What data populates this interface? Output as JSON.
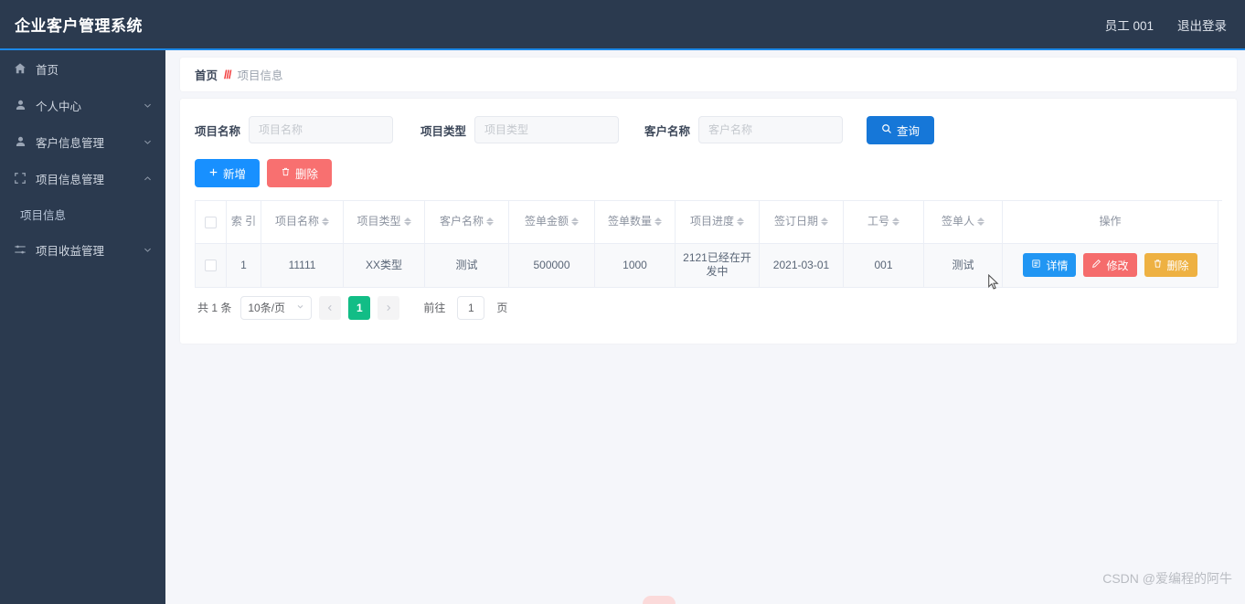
{
  "header": {
    "title": "企业客户管理系统",
    "user": "员工 001",
    "logout": "退出登录"
  },
  "sidebar": {
    "items": [
      {
        "label": "首页",
        "icon": "home-icon",
        "arrow": "",
        "sub": false
      },
      {
        "label": "个人中心",
        "icon": "user-icon",
        "arrow": "chevron-down-icon",
        "sub": false
      },
      {
        "label": "客户信息管理",
        "icon": "user-icon",
        "arrow": "chevron-down-icon",
        "sub": false
      },
      {
        "label": "项目信息管理",
        "icon": "bracket-icon",
        "arrow": "chevron-up-icon",
        "sub": false
      },
      {
        "label": "项目信息",
        "icon": "",
        "arrow": "",
        "sub": true
      },
      {
        "label": "项目收益管理",
        "icon": "sliders-icon",
        "arrow": "chevron-down-icon",
        "sub": false
      }
    ]
  },
  "breadcrumb": {
    "home": "首页",
    "separator": "///",
    "current": "项目信息"
  },
  "filters": {
    "project_name": {
      "label": "项目名称",
      "placeholder": "项目名称",
      "value": ""
    },
    "project_type": {
      "label": "项目类型",
      "placeholder": "项目类型",
      "value": ""
    },
    "customer_name": {
      "label": "客户名称",
      "placeholder": "客户名称",
      "value": ""
    },
    "search_button": "查询",
    "search_icon": "search-icon"
  },
  "toolbar": {
    "add_label": "新增",
    "add_icon": "plus-icon",
    "delete_label": "删除",
    "delete_icon": "trash-icon"
  },
  "table": {
    "columns": [
      {
        "label": "",
        "sortable": false,
        "key": "select"
      },
      {
        "label": "索 引",
        "sortable": false,
        "key": "index"
      },
      {
        "label": "项目名称",
        "sortable": true,
        "key": "project_name"
      },
      {
        "label": "项目类型",
        "sortable": true,
        "key": "project_type"
      },
      {
        "label": "客户名称",
        "sortable": true,
        "key": "customer_name"
      },
      {
        "label": "签单金额",
        "sortable": true,
        "key": "amount"
      },
      {
        "label": "签单数量",
        "sortable": true,
        "key": "quantity"
      },
      {
        "label": "项目进度",
        "sortable": true,
        "key": "progress"
      },
      {
        "label": "签订日期",
        "sortable": true,
        "key": "sign_date"
      },
      {
        "label": "工号",
        "sortable": true,
        "key": "staff_id"
      },
      {
        "label": "签单人",
        "sortable": true,
        "key": "signer"
      },
      {
        "label": "操作",
        "sortable": false,
        "key": "ops"
      }
    ],
    "rows": [
      {
        "index": "1",
        "project_name": "11111",
        "project_type": "XX类型",
        "customer_name": "测试",
        "amount": "500000",
        "quantity": "1000",
        "progress": "2121已经在开发中",
        "sign_date": "2021-03-01",
        "staff_id": "001",
        "signer": "测试"
      }
    ],
    "row_actions": {
      "detail_label": "详情",
      "detail_icon": "document-icon",
      "edit_label": "修改",
      "edit_icon": "pencil-icon",
      "delete_label": "删除",
      "delete_icon": "trash-icon"
    }
  },
  "pagination": {
    "total_text": "共 1 条",
    "page_size": "10条/页",
    "prev_icon": "chevron-left-icon",
    "next_icon": "chevron-right-icon",
    "current_page": "1",
    "goto_label": "前往",
    "goto_value": "1",
    "page_unit": "页"
  },
  "watermark": "CSDN @爱编程的阿牛",
  "colors": {
    "sidebar": "#2b3a4f",
    "primary": "#1890ff",
    "danger": "#f87070",
    "warning": "#eeb142",
    "success": "#12bd86",
    "accent_line": "#1c88e8"
  }
}
